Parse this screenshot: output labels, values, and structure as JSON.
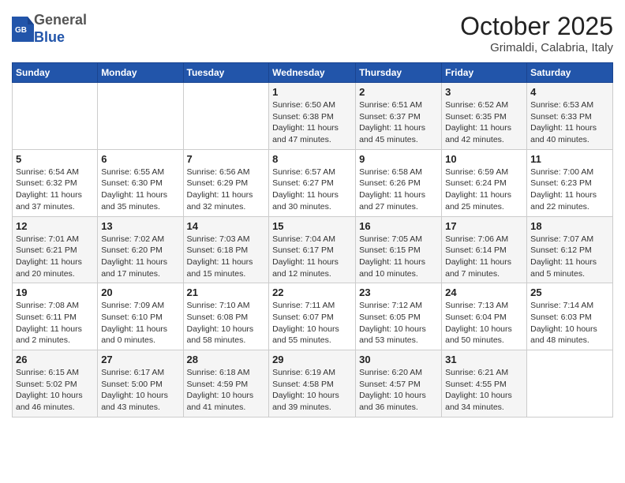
{
  "header": {
    "logo": {
      "general": "General",
      "blue": "Blue"
    },
    "title": "October 2025",
    "location": "Grimaldi, Calabria, Italy"
  },
  "weekdays": [
    "Sunday",
    "Monday",
    "Tuesday",
    "Wednesday",
    "Thursday",
    "Friday",
    "Saturday"
  ],
  "weeks": [
    [
      {
        "day": "",
        "info": ""
      },
      {
        "day": "",
        "info": ""
      },
      {
        "day": "",
        "info": ""
      },
      {
        "day": "1",
        "info": "Sunrise: 6:50 AM\nSunset: 6:38 PM\nDaylight: 11 hours and 47 minutes."
      },
      {
        "day": "2",
        "info": "Sunrise: 6:51 AM\nSunset: 6:37 PM\nDaylight: 11 hours and 45 minutes."
      },
      {
        "day": "3",
        "info": "Sunrise: 6:52 AM\nSunset: 6:35 PM\nDaylight: 11 hours and 42 minutes."
      },
      {
        "day": "4",
        "info": "Sunrise: 6:53 AM\nSunset: 6:33 PM\nDaylight: 11 hours and 40 minutes."
      }
    ],
    [
      {
        "day": "5",
        "info": "Sunrise: 6:54 AM\nSunset: 6:32 PM\nDaylight: 11 hours and 37 minutes."
      },
      {
        "day": "6",
        "info": "Sunrise: 6:55 AM\nSunset: 6:30 PM\nDaylight: 11 hours and 35 minutes."
      },
      {
        "day": "7",
        "info": "Sunrise: 6:56 AM\nSunset: 6:29 PM\nDaylight: 11 hours and 32 minutes."
      },
      {
        "day": "8",
        "info": "Sunrise: 6:57 AM\nSunset: 6:27 PM\nDaylight: 11 hours and 30 minutes."
      },
      {
        "day": "9",
        "info": "Sunrise: 6:58 AM\nSunset: 6:26 PM\nDaylight: 11 hours and 27 minutes."
      },
      {
        "day": "10",
        "info": "Sunrise: 6:59 AM\nSunset: 6:24 PM\nDaylight: 11 hours and 25 minutes."
      },
      {
        "day": "11",
        "info": "Sunrise: 7:00 AM\nSunset: 6:23 PM\nDaylight: 11 hours and 22 minutes."
      }
    ],
    [
      {
        "day": "12",
        "info": "Sunrise: 7:01 AM\nSunset: 6:21 PM\nDaylight: 11 hours and 20 minutes."
      },
      {
        "day": "13",
        "info": "Sunrise: 7:02 AM\nSunset: 6:20 PM\nDaylight: 11 hours and 17 minutes."
      },
      {
        "day": "14",
        "info": "Sunrise: 7:03 AM\nSunset: 6:18 PM\nDaylight: 11 hours and 15 minutes."
      },
      {
        "day": "15",
        "info": "Sunrise: 7:04 AM\nSunset: 6:17 PM\nDaylight: 11 hours and 12 minutes."
      },
      {
        "day": "16",
        "info": "Sunrise: 7:05 AM\nSunset: 6:15 PM\nDaylight: 11 hours and 10 minutes."
      },
      {
        "day": "17",
        "info": "Sunrise: 7:06 AM\nSunset: 6:14 PM\nDaylight: 11 hours and 7 minutes."
      },
      {
        "day": "18",
        "info": "Sunrise: 7:07 AM\nSunset: 6:12 PM\nDaylight: 11 hours and 5 minutes."
      }
    ],
    [
      {
        "day": "19",
        "info": "Sunrise: 7:08 AM\nSunset: 6:11 PM\nDaylight: 11 hours and 2 minutes."
      },
      {
        "day": "20",
        "info": "Sunrise: 7:09 AM\nSunset: 6:10 PM\nDaylight: 11 hours and 0 minutes."
      },
      {
        "day": "21",
        "info": "Sunrise: 7:10 AM\nSunset: 6:08 PM\nDaylight: 10 hours and 58 minutes."
      },
      {
        "day": "22",
        "info": "Sunrise: 7:11 AM\nSunset: 6:07 PM\nDaylight: 10 hours and 55 minutes."
      },
      {
        "day": "23",
        "info": "Sunrise: 7:12 AM\nSunset: 6:05 PM\nDaylight: 10 hours and 53 minutes."
      },
      {
        "day": "24",
        "info": "Sunrise: 7:13 AM\nSunset: 6:04 PM\nDaylight: 10 hours and 50 minutes."
      },
      {
        "day": "25",
        "info": "Sunrise: 7:14 AM\nSunset: 6:03 PM\nDaylight: 10 hours and 48 minutes."
      }
    ],
    [
      {
        "day": "26",
        "info": "Sunrise: 6:15 AM\nSunset: 5:02 PM\nDaylight: 10 hours and 46 minutes."
      },
      {
        "day": "27",
        "info": "Sunrise: 6:17 AM\nSunset: 5:00 PM\nDaylight: 10 hours and 43 minutes."
      },
      {
        "day": "28",
        "info": "Sunrise: 6:18 AM\nSunset: 4:59 PM\nDaylight: 10 hours and 41 minutes."
      },
      {
        "day": "29",
        "info": "Sunrise: 6:19 AM\nSunset: 4:58 PM\nDaylight: 10 hours and 39 minutes."
      },
      {
        "day": "30",
        "info": "Sunrise: 6:20 AM\nSunset: 4:57 PM\nDaylight: 10 hours and 36 minutes."
      },
      {
        "day": "31",
        "info": "Sunrise: 6:21 AM\nSunset: 4:55 PM\nDaylight: 10 hours and 34 minutes."
      },
      {
        "day": "",
        "info": ""
      }
    ]
  ]
}
